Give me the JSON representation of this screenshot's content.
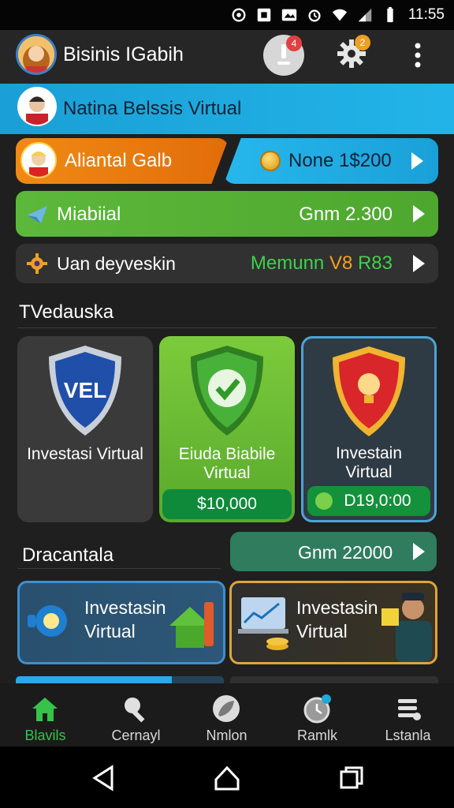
{
  "status_bar": {
    "time": "11:55"
  },
  "app_bar": {
    "title": "Bisinis IGabih",
    "notification_count": "4",
    "settings_badge": "2"
  },
  "banner": {
    "text": "Natina Belssis Virtual"
  },
  "rows": {
    "orange_label": "Aliantal Galb",
    "blue_label": "None 1$200",
    "green_label": "Miabiial",
    "green_value": "Gnm 2.300",
    "dark_label": "Uan deyveskin",
    "dark_value_a": "Memunn",
    "dark_value_b": "V8",
    "dark_value_c": "R83"
  },
  "section1": {
    "title": "TVedauska"
  },
  "cards": [
    {
      "shield_text": "VEL",
      "caption_line1": "Investasi Virtual",
      "caption_line2": "",
      "price": ""
    },
    {
      "shield_text": "",
      "caption_line1": "Eiuda Biabile",
      "caption_line2": "Virtual",
      "price": "$10,000"
    },
    {
      "shield_text": "",
      "caption_line1": "Investain",
      "caption_line2": "Virtual",
      "price": "D19,0:00"
    }
  ],
  "section2": {
    "title": "Dracantala",
    "button_label": "Gnm 22000"
  },
  "tiles": [
    {
      "line1": "Investasin",
      "line2": "Virtual"
    },
    {
      "line1": "Investasin",
      "line2": "Virtual"
    }
  ],
  "progress": 0.75,
  "bottom_nav": [
    {
      "label": "Blavils",
      "icon": "home-icon",
      "active": true
    },
    {
      "label": "Cernayl",
      "icon": "tools-icon",
      "active": false
    },
    {
      "label": "Nmlon",
      "icon": "leaf-icon",
      "active": false
    },
    {
      "label": "Ramlk",
      "icon": "clock-icon",
      "active": false
    },
    {
      "label": "Lstanla",
      "icon": "list-icon",
      "active": false
    }
  ],
  "colors": {
    "accent_green": "#37c24a",
    "banner_blue": "#1a9fd6",
    "orange": "#f08a14"
  }
}
